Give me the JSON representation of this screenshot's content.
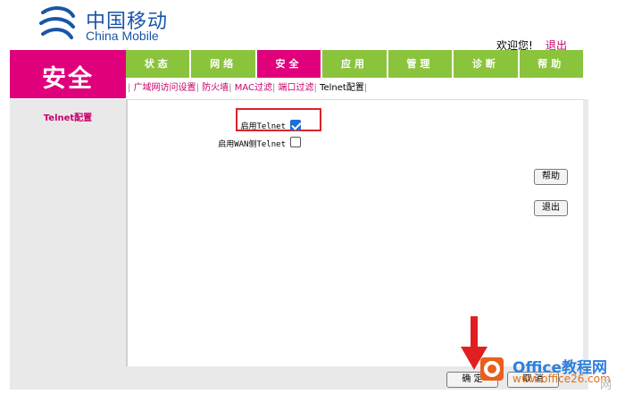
{
  "header": {
    "logo_cn": "中国移动",
    "logo_en": "China Mobile",
    "welcome": "欢迎您!",
    "logout": "退出"
  },
  "page_title": "安全",
  "nav": {
    "tabs": [
      "状态",
      "网络",
      "安全",
      "应用",
      "管理",
      "诊断",
      "帮助"
    ],
    "active_index": 2
  },
  "subnav": [
    "广域网访问设置",
    "防火墙",
    "MAC过滤",
    "端口过滤",
    "Telnet配置"
  ],
  "sidebar": {
    "item": "Telnet配置"
  },
  "form": {
    "enable_telnet_label": "启用Telnet",
    "enable_telnet_checked": true,
    "enable_wan_telnet_label": "启用WAN侧Telnet",
    "enable_wan_telnet_checked": false
  },
  "buttons": {
    "help": "帮助",
    "exit": "退出",
    "confirm": "确 定",
    "cancel": "取 消"
  },
  "watermark": {
    "text": "Office教程网",
    "url": "www.office26.com",
    "corner": "网"
  },
  "colors": {
    "brand_magenta": "#e0007b",
    "nav_green": "#8ac43c",
    "highlight_red": "#d8232a",
    "logo_blue": "#1a55a8"
  }
}
